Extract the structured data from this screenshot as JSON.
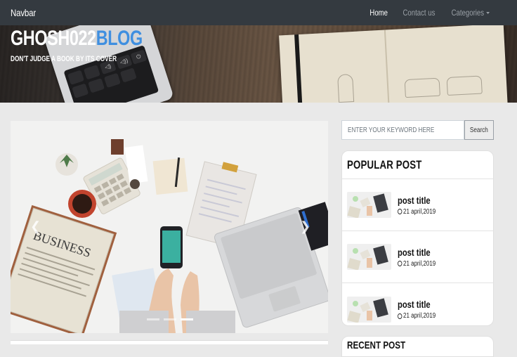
{
  "navbar": {
    "brand": "Navbar",
    "links": [
      {
        "label": "Home",
        "active": true
      },
      {
        "label": "Contact us",
        "active": false
      },
      {
        "label": "Categories",
        "active": false,
        "dropdown": true
      }
    ]
  },
  "hero": {
    "title_main": "GHOSH022",
    "title_accent": "BLOG",
    "tagline": "DON'T JUDGE A BOOK BY ITS COVER",
    "accent_color": "#3f8fe0"
  },
  "carousel": {
    "prev_icon": "chevron-left-icon",
    "next_icon": "chevron-right-icon",
    "slides": 3,
    "active_slide": 3,
    "newspaper_text": "BUSINESS"
  },
  "search": {
    "placeholder": "ENTER YOUR KEYWORD HERE",
    "button_label": "Search"
  },
  "popular": {
    "heading": "POPULAR POST",
    "posts": [
      {
        "title": "post title",
        "date": "21 april,2019"
      },
      {
        "title": "post title",
        "date": "21 april,2019"
      },
      {
        "title": "post title",
        "date": "21 april,2019"
      }
    ]
  },
  "recent": {
    "heading": "RECENT POST"
  }
}
